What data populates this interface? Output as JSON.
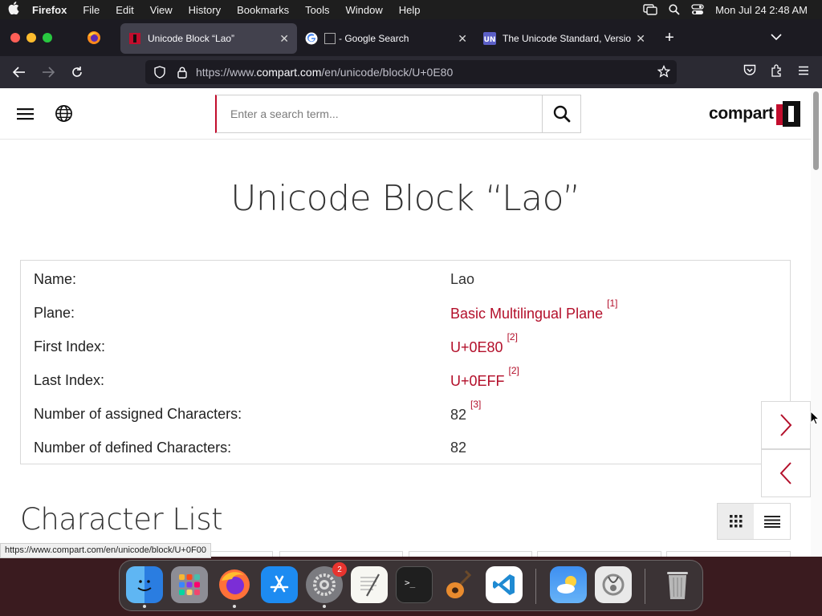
{
  "menubar": {
    "app_name": "Firefox",
    "items": [
      "File",
      "Edit",
      "View",
      "History",
      "Bookmarks",
      "Tools",
      "Window",
      "Help"
    ],
    "clock": "Mon Jul 24  2:48 AM"
  },
  "tabs": [
    {
      "title": "Unicode Block “Lao”",
      "active": true
    },
    {
      "title": "- Google Search",
      "active": false
    },
    {
      "title": "The Unicode Standard, Version",
      "active": false
    }
  ],
  "urlbar": {
    "prefix": "https://www.",
    "domain": "compart.com",
    "path": "/en/unicode/block/U+0E80"
  },
  "site": {
    "search_placeholder": "Enter a search term...",
    "logo_text": "compart"
  },
  "page": {
    "title": "Unicode Block “Lao”",
    "info": [
      {
        "label": "Name:",
        "value": "Lao",
        "link": false,
        "ref": ""
      },
      {
        "label": "Plane:",
        "value": "Basic Multilingual Plane",
        "link": true,
        "ref": "[1]"
      },
      {
        "label": "First Index:",
        "value": "U+0E80",
        "link": true,
        "ref": "[2]"
      },
      {
        "label": "Last Index:",
        "value": "U+0EFF",
        "link": true,
        "ref": "[2]"
      },
      {
        "label": "Number of assigned Characters:",
        "value": "82",
        "link": false,
        "ref": "[3]"
      },
      {
        "label": "Number of defined Characters:",
        "value": "82",
        "link": false,
        "ref": ""
      }
    ],
    "section_title": "Character List"
  },
  "status_url": "https://www.compart.com/en/unicode/block/U+0F00",
  "dock": {
    "settings_badge": "2"
  },
  "colors": {
    "brand_red": "#b30f2a",
    "search_accent": "#c20d2d"
  }
}
